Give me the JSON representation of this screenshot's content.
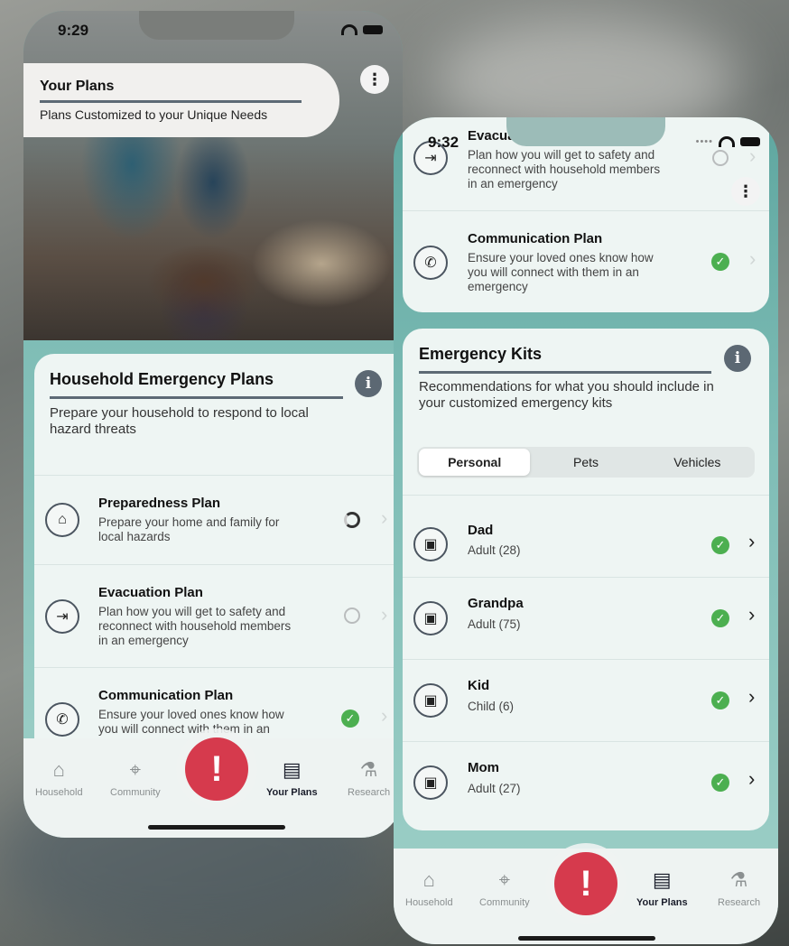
{
  "left_phone": {
    "status": {
      "time": "9:29"
    },
    "header": {
      "title": "Your Plans",
      "subtitle": "Plans Customized to your Unique Needs"
    },
    "plans_card": {
      "title": "Household Emergency Plans",
      "description": "Prepare your household to respond to local hazard threats",
      "rows": [
        {
          "title": "Preparedness Plan",
          "desc": "Prepare your home and family for local hazards",
          "status": "in-progress"
        },
        {
          "title": "Evacuation Plan",
          "desc": "Plan how you will get to safety and reconnect with household members in an emergency",
          "status": "not-started"
        },
        {
          "title": "Communication Plan",
          "desc": "Ensure your loved ones know how you will connect with them in an emergency",
          "status": "complete"
        }
      ]
    },
    "tabs": [
      {
        "label": "Household",
        "icon": "house-icon"
      },
      {
        "label": "Community",
        "icon": "map-pin-icon"
      },
      {
        "label": "Your Plans",
        "icon": "clipboard-icon"
      },
      {
        "label": "Research",
        "icon": "flask-icon"
      }
    ],
    "alert_label": "!"
  },
  "right_phone": {
    "status": {
      "time": "9:32"
    },
    "top_rows": [
      {
        "title": "Evacuation Plan",
        "desc": "Plan how you will get to safety and reconnect with household members in an emergency",
        "status": "not-started"
      },
      {
        "title": "Communication Plan",
        "desc": "Ensure your loved ones know how you will connect with them in an emergency",
        "status": "complete"
      }
    ],
    "kits_card": {
      "title": "Emergency Kits",
      "description": "Recommendations for what you should include in your customized emergency kits",
      "segments": [
        "Personal",
        "Pets",
        "Vehicles"
      ],
      "selected_segment": "Personal",
      "rows": [
        {
          "name": "Dad",
          "detail": "Adult (28)",
          "status": "complete"
        },
        {
          "name": "Grandpa",
          "detail": "Adult (75)",
          "status": "complete"
        },
        {
          "name": "Kid",
          "detail": "Child (6)",
          "status": "complete"
        },
        {
          "name": "Mom",
          "detail": "Adult (27)",
          "status": "complete"
        }
      ]
    },
    "tabs": [
      {
        "label": "Household",
        "icon": "house-icon"
      },
      {
        "label": "Community",
        "icon": "map-pin-icon"
      },
      {
        "label": "Your Plans",
        "icon": "clipboard-icon"
      },
      {
        "label": "Research",
        "icon": "flask-icon"
      }
    ],
    "alert_label": "!"
  },
  "colors": {
    "accent_red": "#d63a4d",
    "check_green": "#4caf50",
    "underline": "#5d6a75",
    "card_bg": "#eef5f3"
  }
}
